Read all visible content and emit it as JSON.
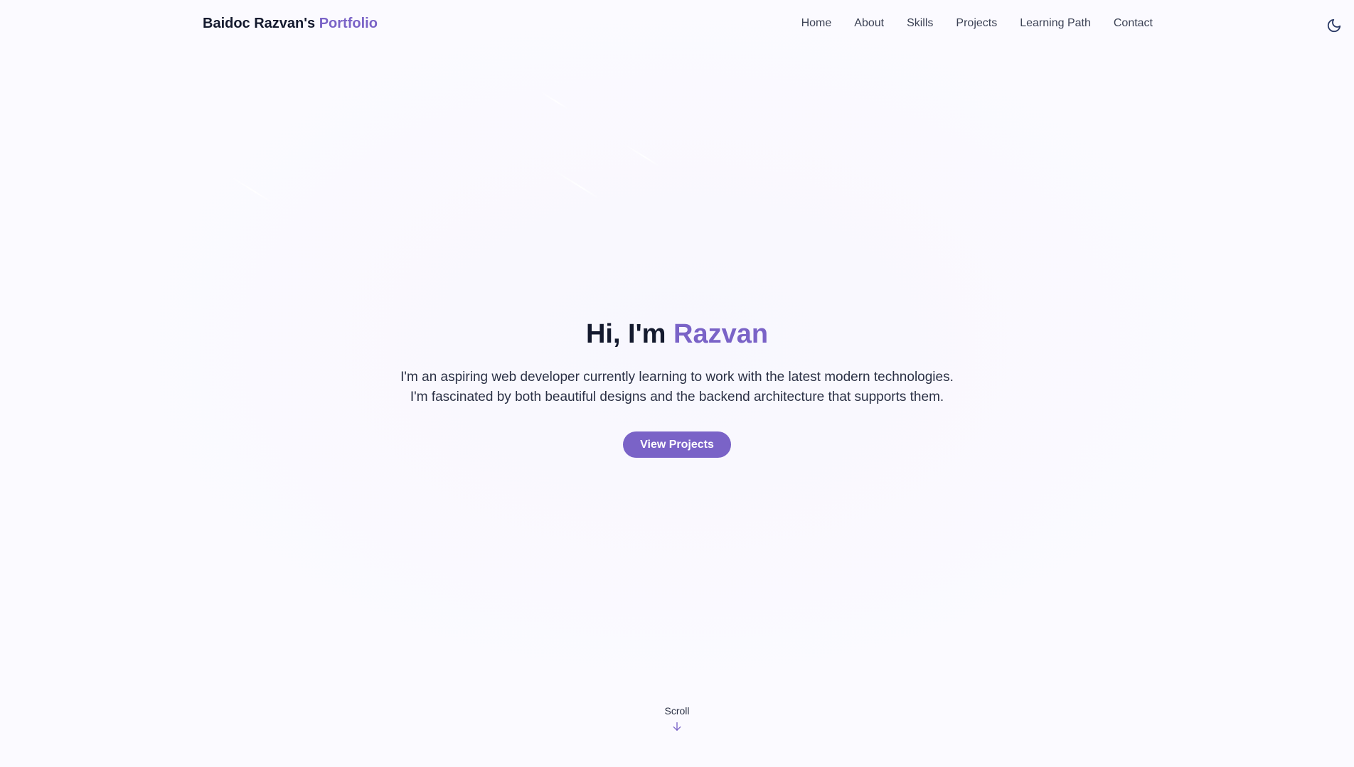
{
  "brand": {
    "name": "Baidoc Razvan's",
    "accent": "Portfolio"
  },
  "nav": {
    "items": [
      {
        "label": "Home"
      },
      {
        "label": "About"
      },
      {
        "label": "Skills"
      },
      {
        "label": "Projects"
      },
      {
        "label": "Learning Path"
      },
      {
        "label": "Contact"
      }
    ],
    "theme_toggle_icon": "moon-icon"
  },
  "hero": {
    "title_prefix": "Hi, I'm",
    "title_name": "Razvan",
    "desc_line1": "I'm an aspiring web developer currently learning to work with the latest modern technologies.",
    "desc_line2": "I'm fascinated by both beautiful designs and the backend architecture that supports them.",
    "cta_label": "View Projects"
  },
  "scroll": {
    "label": "Scroll",
    "icon": "arrow-down-icon"
  },
  "colors": {
    "accent": "#7a63c7",
    "text": "#141a2e",
    "background": "#fbfaff"
  }
}
